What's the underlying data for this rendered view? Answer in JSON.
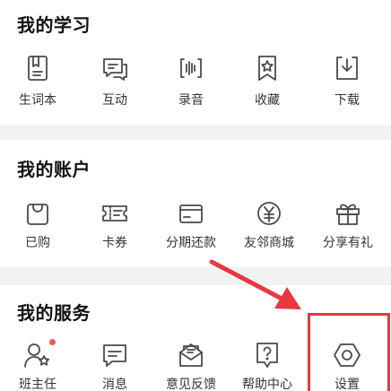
{
  "sections": {
    "study": {
      "title": "我的学习",
      "items": [
        {
          "label": "生词本",
          "icon": "vocabulary-book-icon"
        },
        {
          "label": "互动",
          "icon": "chat-bubble-icon"
        },
        {
          "label": "录音",
          "icon": "recording-waveform-icon"
        },
        {
          "label": "收藏",
          "icon": "bookmark-star-icon"
        },
        {
          "label": "下载",
          "icon": "download-icon"
        }
      ]
    },
    "account": {
      "title": "我的账户",
      "items": [
        {
          "label": "已购",
          "icon": "shopping-bag-icon"
        },
        {
          "label": "卡券",
          "icon": "coupon-icon"
        },
        {
          "label": "分期还款",
          "icon": "card-icon"
        },
        {
          "label": "友邻商城",
          "icon": "yuan-coin-icon"
        },
        {
          "label": "分享有礼",
          "icon": "gift-icon"
        }
      ]
    },
    "service": {
      "title": "我的服务",
      "items": [
        {
          "label": "班主任",
          "icon": "tutor-person-icon",
          "badge": true
        },
        {
          "label": "消息",
          "icon": "message-icon"
        },
        {
          "label": "意见反馈",
          "icon": "feedback-envelope-icon"
        },
        {
          "label": "帮助中心",
          "icon": "help-question-icon"
        },
        {
          "label": "设置",
          "icon": "settings-hexagon-icon"
        }
      ]
    }
  },
  "colors": {
    "icon_stroke": "#4a4a4a",
    "badge": "#f05a5a",
    "annotation": "#e5383f",
    "background": "#f1f2f4"
  }
}
